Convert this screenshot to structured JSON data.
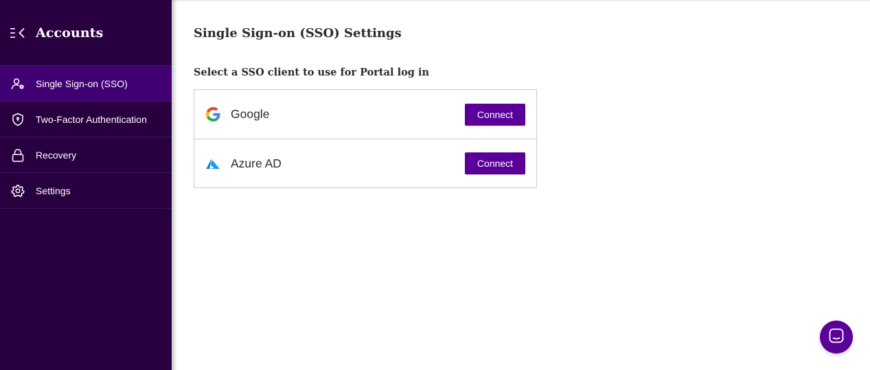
{
  "sidebar": {
    "title": "Accounts",
    "collapse_icon": "collapse-menu-icon",
    "items": [
      {
        "label": "Single Sign-on (SSO)",
        "icon": "user-gear-icon",
        "active": true
      },
      {
        "label": "Two-Factor Authentication",
        "icon": "shield-icon",
        "active": false
      },
      {
        "label": "Recovery",
        "icon": "lock-icon",
        "active": false
      },
      {
        "label": "Settings",
        "icon": "gear-icon",
        "active": false
      }
    ]
  },
  "main": {
    "title": "Single Sign-on (SSO) Settings",
    "subtitle": "Select a SSO client to use for Portal log in",
    "providers": [
      {
        "name": "Google",
        "icon": "google-logo-icon",
        "button_label": "Connect"
      },
      {
        "name": "Azure AD",
        "icon": "azure-logo-icon",
        "button_label": "Connect"
      }
    ]
  },
  "chat": {
    "icon": "chat-icon"
  },
  "colors": {
    "sidebar_bg": "#280040",
    "sidebar_active": "#410072",
    "accent": "#5a0099"
  }
}
